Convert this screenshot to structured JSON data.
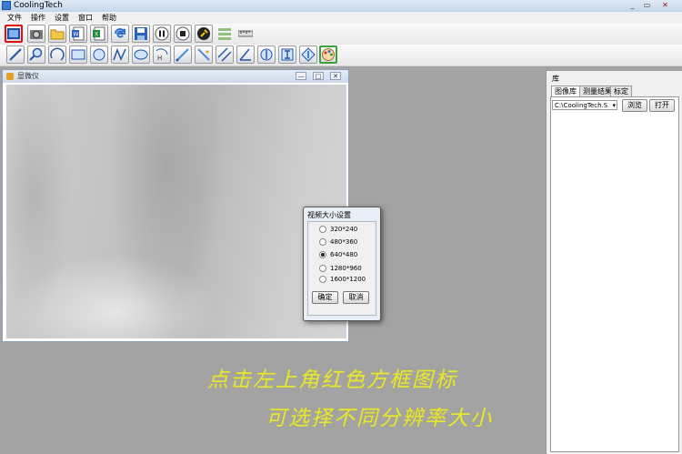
{
  "app": {
    "title": "CoolingTech",
    "window_buttons": [
      "_",
      "▭",
      "✕"
    ]
  },
  "menu": [
    "文件",
    "操作",
    "设置",
    "窗口",
    "帮助"
  ],
  "toolbar1": [
    {
      "name": "video-size-icon"
    },
    {
      "name": "camera-icon"
    },
    {
      "name": "open-folder-icon"
    },
    {
      "name": "word-export-icon"
    },
    {
      "name": "excel-export-icon"
    },
    {
      "name": "refresh-icon"
    },
    {
      "name": "save-icon"
    },
    {
      "name": "pause-icon"
    },
    {
      "name": "stop-icon"
    },
    {
      "name": "wrench-icon"
    },
    {
      "name": "scale-bar-icon"
    },
    {
      "name": "ruler-icon"
    }
  ],
  "toolbar2": [
    {
      "name": "line-icon"
    },
    {
      "name": "zoom-icon"
    },
    {
      "name": "arc-icon"
    },
    {
      "name": "rectangle-icon"
    },
    {
      "name": "circle-icon"
    },
    {
      "name": "polyline-icon"
    },
    {
      "name": "ellipse-icon"
    },
    {
      "name": "height-icon"
    },
    {
      "name": "diagonal-icon"
    },
    {
      "name": "point-line-icon"
    },
    {
      "name": "parallel-icon"
    },
    {
      "name": "angle-icon"
    },
    {
      "name": "circle-center-icon"
    },
    {
      "name": "text-icon"
    },
    {
      "name": "diamond-icon"
    },
    {
      "name": "palette-icon"
    }
  ],
  "child_window": {
    "title": "显微仪",
    "buttons": [
      "—",
      "□",
      "✕"
    ]
  },
  "library": {
    "title": "库",
    "tabs": [
      "图像库",
      "测量结果",
      "标定"
    ],
    "path_value": "C:\\CoolingTech.S",
    "browse_label": "浏览",
    "open_label": "打开"
  },
  "dialog": {
    "title": "视频大小设置",
    "options": [
      "320*240",
      "480*360",
      "640*480",
      "1280*960",
      "1600*1200"
    ],
    "selected": "640*480",
    "ok_label": "确定",
    "cancel_label": "取消"
  },
  "caption": {
    "line1": "点击左上角红色方框图标",
    "line2": "可选择不同分辨率大小",
    "color": "#e6e63a"
  }
}
